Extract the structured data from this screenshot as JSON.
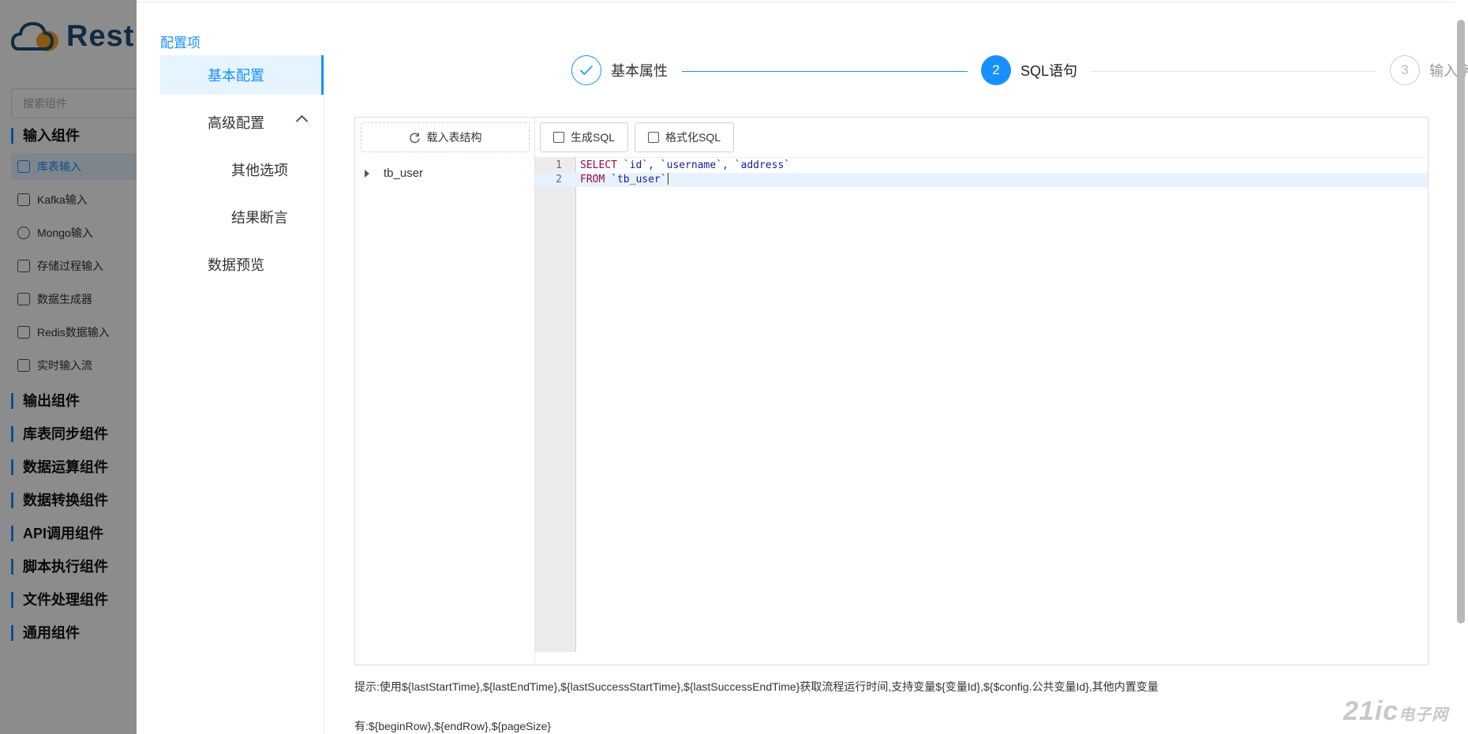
{
  "app": {
    "logo_text": "Rest",
    "search_placeholder": "搜索组件",
    "groups": {
      "input": "输入组件",
      "output": "输出组件",
      "sync": "库表同步组件",
      "compute": "数据运算组件",
      "convert": "数据转换组件",
      "api": "API调用组件",
      "script": "脚本执行组件",
      "file": "文件处理组件",
      "common": "通用组件"
    },
    "input_components": [
      "库表输入",
      "Kafka输入",
      "Mongo输入",
      "存储过程输入",
      "数据生成器",
      "Redis数据输入",
      "实时输入流"
    ]
  },
  "drawer": {
    "section_title": "配置项",
    "nav": {
      "basic": "基本配置",
      "advanced": "高级配置",
      "other": "其他选项",
      "assert": "结果断言",
      "preview": "数据预览"
    },
    "steps": [
      {
        "label": "基本属性",
        "status": "done",
        "number": "1"
      },
      {
        "label": "SQL语句",
        "status": "current",
        "number": "2"
      },
      {
        "label": "输入字段",
        "status": "wait",
        "number": "3"
      }
    ],
    "load_button": "载入表结构",
    "tree_item": "tb_user",
    "toolbar": {
      "generate": "生成SQL",
      "format": "格式化SQL"
    },
    "code_lines": [
      {
        "no": "1",
        "kw": "SELECT",
        "rest": " `id`, `username`, `address`"
      },
      {
        "no": "2",
        "kw": "FROM",
        "rest": " `tb_user`"
      }
    ],
    "hint_line1": "提示:使用${lastStartTime},${lastEndTime},${lastSuccessStartTime},${lastSuccessEndTime}获取流程运行时间,支持变量${变量Id},${$config.公共变量Id},其他内置变量",
    "hint_line2": "有:${beginRow},${endRow},${pageSize}"
  },
  "watermark": {
    "main": "21ic",
    "sub": "电子网"
  },
  "colors": {
    "accent": "#1890ff",
    "active_bg": "#e6f4ff",
    "mask": "rgba(0,0,0,0.45)"
  }
}
